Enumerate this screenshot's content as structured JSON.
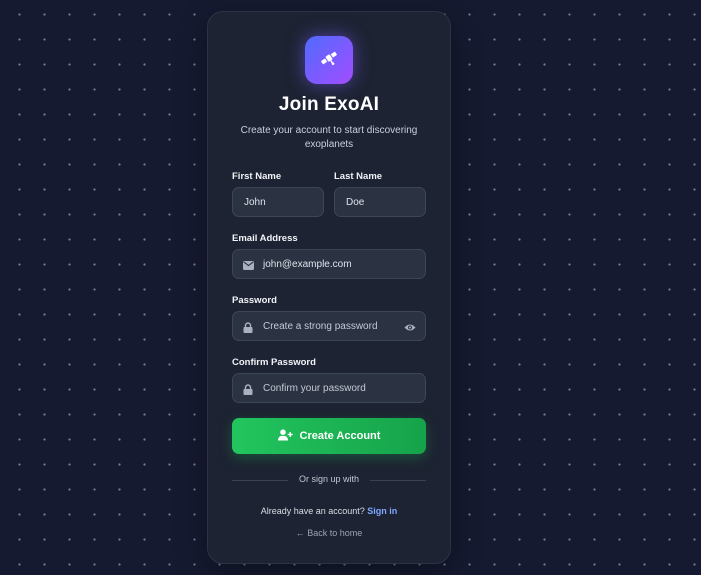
{
  "brand": {
    "title": "Join ExoAI",
    "subtitle": "Create your account to start discovering exoplanets",
    "logo_icon": "satellite-icon",
    "accent_gradient": [
      "#4f6bff",
      "#a34dff"
    ]
  },
  "form": {
    "first_name": {
      "label": "First Name",
      "value": "John"
    },
    "last_name": {
      "label": "Last Name",
      "value": "Doe"
    },
    "email": {
      "label": "Email Address",
      "value": "john@example.com"
    },
    "password": {
      "label": "Password",
      "placeholder": "Create a strong password"
    },
    "confirm_password": {
      "label": "Confirm Password",
      "placeholder": "Confirm your password"
    },
    "submit_label": "Create Account"
  },
  "footer": {
    "divider_text": "Or sign up with",
    "have_account_text": "Already have an account?",
    "sign_in_label": "Sign in",
    "back_label": "Back to home"
  },
  "colors": {
    "primary_button": "#22c55e",
    "link": "#7fa7ff",
    "card_bg": "#1d2332",
    "page_bg": "#161a30"
  }
}
